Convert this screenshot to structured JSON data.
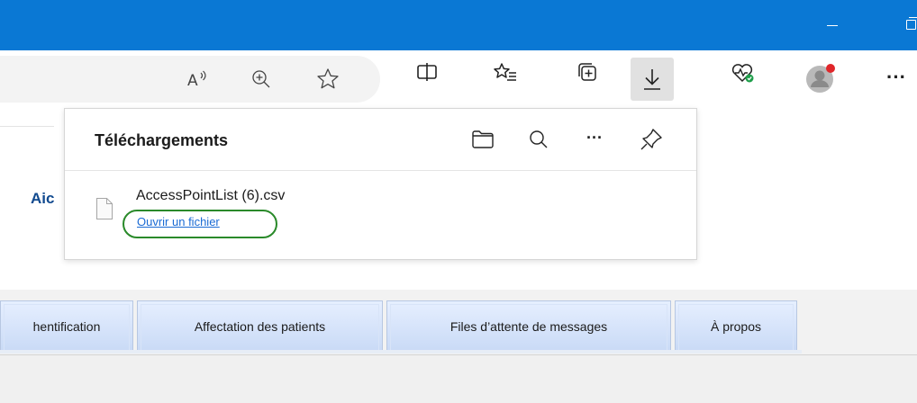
{
  "window": {
    "title_bar_color": "#0a78d4"
  },
  "toolbar": {
    "icons": [
      "read-aloud-icon",
      "zoom-icon",
      "favorite-star-icon",
      "split-screen-icon",
      "favorites-list-icon",
      "collections-icon",
      "download-icon",
      "browser-essentials-icon",
      "profile-avatar-icon",
      "more-options-icon"
    ],
    "more_label": "···"
  },
  "page": {
    "partial_heading": "Aic"
  },
  "downloads_panel": {
    "title": "Téléchargements",
    "more_label": "···",
    "items": [
      {
        "filename": "AccessPointList (6).csv",
        "action": "Ouvrir un fichier"
      }
    ],
    "highlight_color": "#2a8a2a"
  },
  "tabs": [
    {
      "label": "hentification"
    },
    {
      "label": "Affectation des patients"
    },
    {
      "label": "Files d’attente de messages"
    },
    {
      "label": "À propos"
    }
  ]
}
